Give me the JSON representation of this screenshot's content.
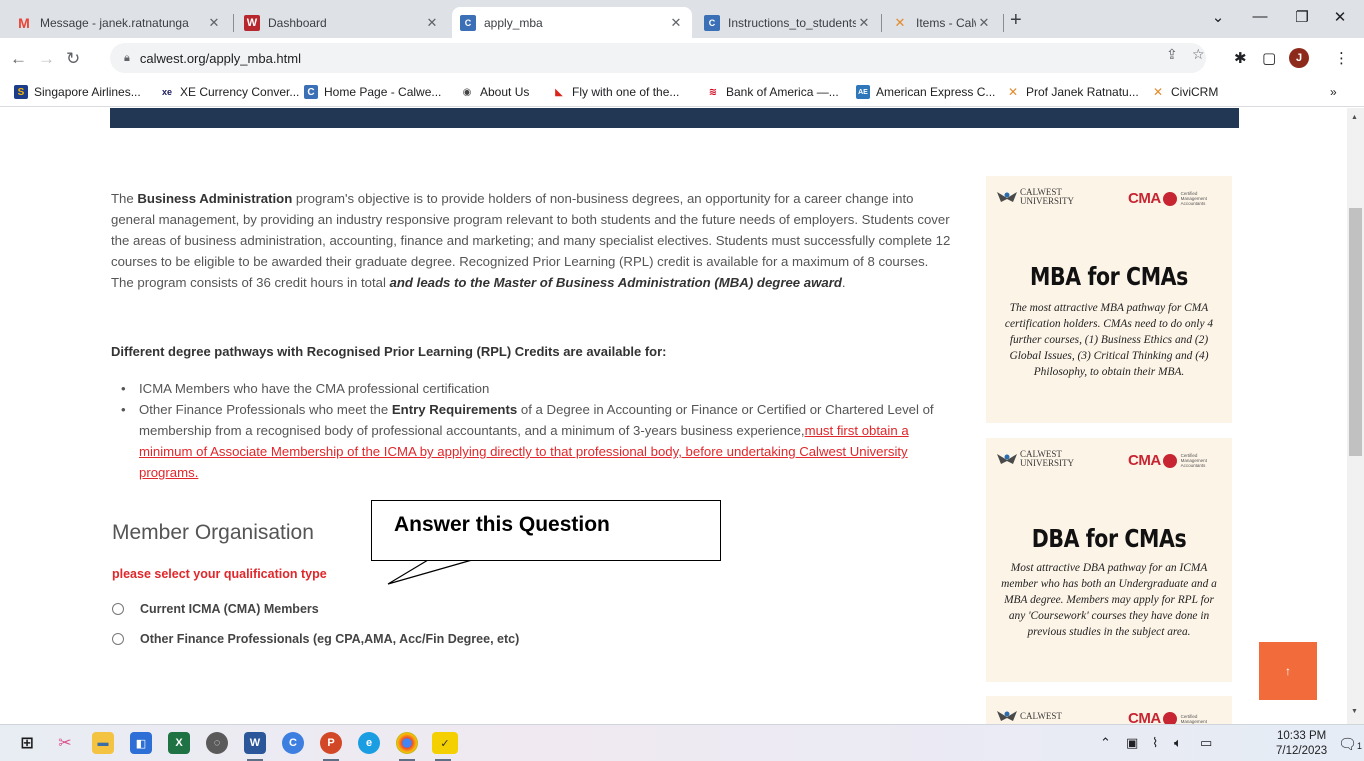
{
  "browser": {
    "tabs": [
      {
        "title": "Message - janek.ratnatunga",
        "icon": "gmail-icon",
        "active": false
      },
      {
        "title": "Dashboard",
        "icon": "word-icon",
        "active": false
      },
      {
        "title": "apply_mba",
        "icon": "site-icon",
        "active": true
      },
      {
        "title": "Instructions_to_students_Pro",
        "icon": "site-icon",
        "active": false
      },
      {
        "title": "Items - Calwest University -",
        "icon": "civicrm-icon",
        "active": false
      }
    ],
    "url": "calwest.org/apply_mba.html",
    "profile_initial": "J",
    "bookmarks": [
      "Singapore Airlines...",
      "XE Currency Conver...",
      "Home Page - Calwe...",
      "About Us",
      "Fly with one of the...",
      "Bank of America —...",
      "American Express C...",
      "Prof Janek Ratnatu...",
      "CiviCRM"
    ],
    "bookmarks_overflow": "»"
  },
  "page": {
    "intro": {
      "p1": "The ",
      "b1": "Business Administration",
      "p2": " program's objective is to provide holders of non-business degrees, an opportunity for a career change into general management, by providing an industry responsive program relevant to both students and the future needs of employers. Students cover the areas of business administration, accounting, finance and marketing; and many specialist electives. Students must successfully complete 12 courses to be eligible to be awarded their graduate degree. Recognized Prior Learning (RPL) credit is available for a maximum of 8 courses. The program consists of 36 credit hours in total ",
      "b2": "and leads to the Master of Business Administration (MBA) degree award",
      "p3": "."
    },
    "pathways_heading": "Different degree pathways with Recognised Prior Learning (RPL) Credits are available for:",
    "pathways": {
      "item1": "ICMA Members who have the CMA professional certification",
      "item2_a": "Other Finance Professionals who meet the ",
      "item2_b": "Entry Requirements",
      "item2_c": " of a Degree in Accounting or Finance or Certified or Chartered Level of membership from a recognised body of professional accountants, and a minimum of 3-years business experience,",
      "item2_link": "must first obtain a minimum of Associate Membership of the ICMA by applying directly to that professional body, before undertaking Calwest University programs."
    },
    "member_heading": "Member Organisation",
    "qualification_label": "please select your qualification type",
    "options": [
      "Current ICMA (CMA) Members",
      "Other Finance Professionals (eg CPA,AMA, Acc/Fin Degree, etc)"
    ],
    "callout": "Answer this Question",
    "scroll_top": "↑"
  },
  "ads": [
    {
      "univ": "CALWEST\nUNIVERSITY",
      "cma": "CMA",
      "cma_small": "Certified Management Accountants",
      "title": "MBA for CMAs",
      "body": "The most attractive MBA pathway for CMA certification holders.  CMAs need to do only 4 further courses, (1) Business Ethics and (2) Global Issues, (3) Critical Thinking and (4) Philosophy, to obtain their MBA."
    },
    {
      "univ": "CALWEST\nUNIVERSITY",
      "cma": "CMA",
      "cma_small": "Certified Management Accountants",
      "title": "DBA for CMAs",
      "body": "Most attractive DBA pathway for an ICMA member who has both an Undergraduate and a MBA degree. Members may apply for RPL for any 'Coursework' courses they have done in previous studies in the subject area."
    },
    {
      "univ": "CALWEST",
      "cma": "CMA",
      "cma_small": "Certified Management"
    }
  ],
  "taskbar": {
    "time": "10:33 PM",
    "date": "7/12/2023",
    "notifications": "1"
  },
  "colors": {
    "banner": "#213754",
    "accent_red": "#e0272b",
    "scroll_top_button": "#f26b3a",
    "ad_background": "#fdf4e8"
  }
}
